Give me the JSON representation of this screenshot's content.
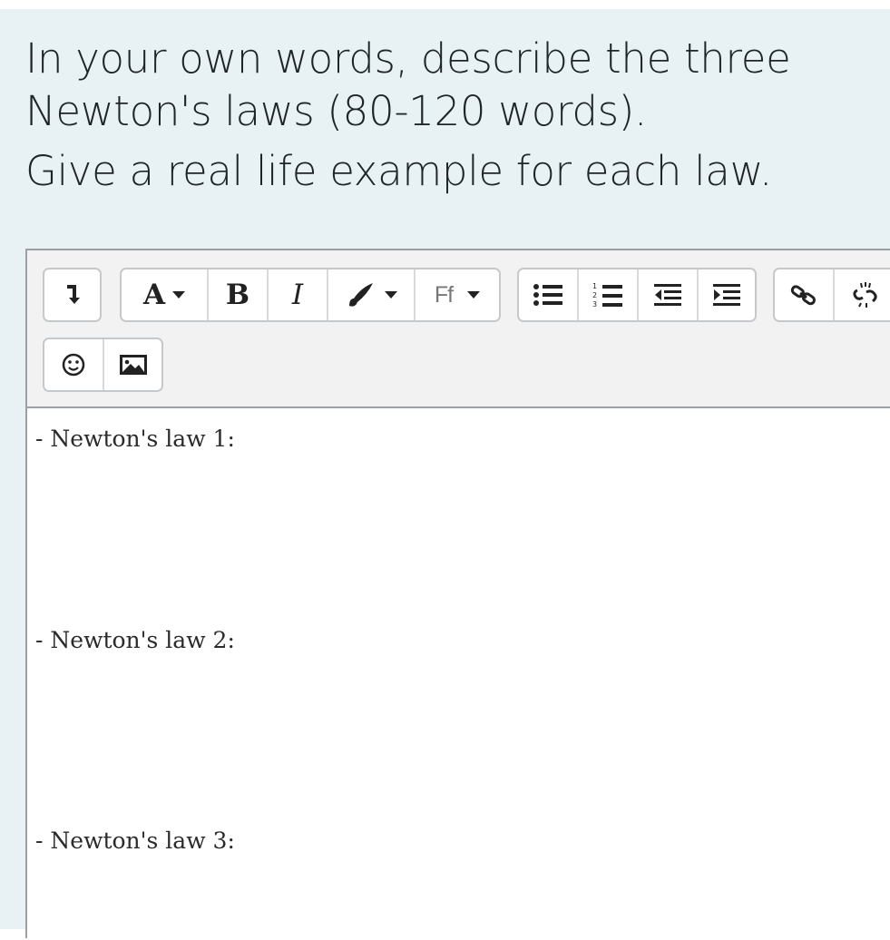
{
  "question": {
    "line1": "In your own words, describe the three",
    "line2": "Newton's laws  (80-120 words).",
    "line3": "Give a real life example for each law."
  },
  "toolbar": {
    "icons": {
      "toggle": "arrow-down-right-icon",
      "text_color": "text-color-icon",
      "bold": "bold-icon",
      "italic": "italic-icon",
      "brush": "paintbrush-icon",
      "font_family": "font-family-icon",
      "bullet_list": "bullet-list-icon",
      "numbered_list": "numbered-list-icon",
      "outdent": "outdent-icon",
      "indent": "indent-icon",
      "link": "link-icon",
      "unlink": "unlink-icon",
      "emoji": "emoji-icon",
      "image": "image-icon"
    },
    "text_color_label": "A",
    "bold_label": "B",
    "italic_label": "I",
    "font_family_label": "Ff"
  },
  "editor": {
    "lines": [
      "- Newton's law 1:",
      "- Newton's law 2:",
      "- Newton's law 3:"
    ]
  },
  "colors": {
    "panel_background": "#e8f2f5",
    "toolbar_background": "#f2f2f2",
    "border": "#9aa0a6"
  }
}
